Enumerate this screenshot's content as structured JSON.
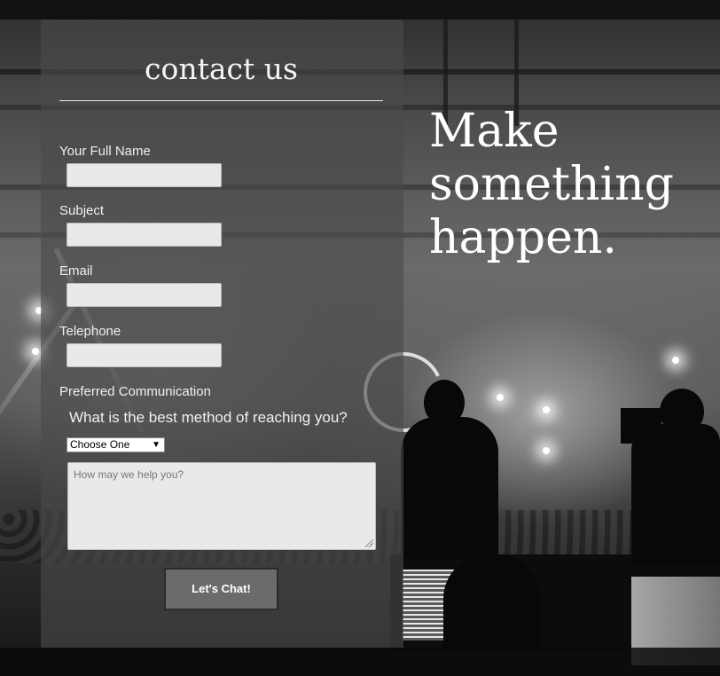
{
  "form": {
    "title": "contact us",
    "fields": [
      {
        "label": "Your Full Name",
        "value": ""
      },
      {
        "label": "Subject",
        "value": ""
      },
      {
        "label": "Email",
        "value": ""
      },
      {
        "label": "Telephone",
        "value": ""
      }
    ],
    "preferred": {
      "label": "Preferred Communication",
      "question": "What is the best method of reaching you?",
      "selected": "Choose One",
      "arrow": "▼"
    },
    "message_placeholder": "How may we help you?",
    "submit_label": "Let's Chat!"
  },
  "hero": {
    "lines": [
      "Make",
      "something",
      "happen."
    ]
  },
  "colors": {
    "panel": "#4b4b4b",
    "field": "#e9e9e9",
    "button": "#6b6b6b",
    "text": "#ffffff"
  }
}
